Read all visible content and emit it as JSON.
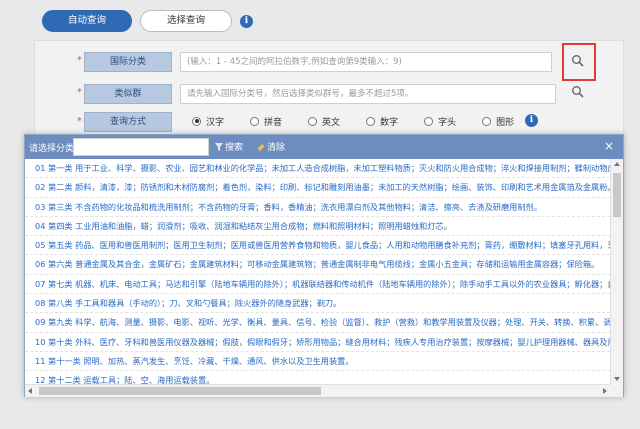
{
  "tabs": {
    "auto_query": "自动查询",
    "manual_query": "选择查询"
  },
  "form": {
    "intl_class_label": "国际分类",
    "intl_class_placeholder": "(输入：1 - 45之间的阿拉伯数字,例如查询第9类输入：9)",
    "similar_group_label": "类似群",
    "similar_group_placeholder": "请先输入国际分类号，然后选择类似群号，最多不超过5项。",
    "query_method_label": "查询方式",
    "methods": [
      "汉字",
      "拼音",
      "英文",
      "数字",
      "字头",
      "图形"
    ],
    "selected_method": "汉字"
  },
  "modal": {
    "title": "请选择分类",
    "search_label": "搜索",
    "clear_label": "清除",
    "close_symbol": "×",
    "items": [
      "01 第一类 用于工业、科学、摄影、农业、园艺和林业的化学品；未加工人造合成树脂，未加工塑料物质；灭火和防火用合成物；淬火和焊接用制剂；鞣制动物皮毛用物质；工",
      "02 第二类 颜料，清漆，漆；防锈剂和木材防腐剂；着色剂，染料；印刷、标记和雕刻用油墨；未加工的天然树脂；绘画、装饰、印刷和艺术用金属箔及金属粉。",
      "03 第三类 不含药物的化妆品和梳洗用制剂；不含药物的牙膏；香料，香精油；洗衣用漂白剂及其他物料；清洁、擦亮、去渍及研磨用制剂。",
      "04 第四类 工业用油和油脂，蜡；润滑剂；吸收、润湿和粘结灰尘用合成物；燃料和照明材料；照明用蜡烛和灯芯。",
      "05 第五类 药品、医用和兽医用制剂；医用卫生制剂；医用或兽医用营养食物和物质，婴儿食品；人用和动物用膳食补充剂；膏药，绷敷材料；填塞牙孔用料，牙科用蜡；消毒",
      "06 第六类 普通金属及其合金，金属矿石；金属建筑材料；可移动金属建筑物；普通金属制非电气用缆线；金属小五金具；存储和运输用金属容器；保险箱。",
      "07 第七类 机器、机床、电动工具；马达和引擎（陆地车辆用的除外）；机器联结器和传动机件（陆地车辆用的除外）；除手动手工具以外的农业器具；孵化器；自动售货机。",
      "08 第八类 手工具和器具（手动的）；刀、叉和勺餐具；除火器外的随身武器；剃刀。",
      "09 第九类 科学、航海、测量、摄影、电影、视听、光学、衡具、量具、信号、检验（监督）、救护（营救）和教学用装置及仪器；处理、开关、转换、积累、调节或控制电的装置和",
      "10 第十类 外科、医疗、牙科和兽医用仪器及器械；假肢，假眼和假牙；矫形用物品；缝合用材料；残疾人专用治疗装置；按摩器械；婴儿护理用器械、器具及用品；性生活用",
      "11 第十一类 照明、加热、蒸汽发生、烹饪、冷藏、干燥、通风、供水以及卫生用装置。",
      "12 第十二类 运载工具；陆、空、海用运载装置。"
    ]
  },
  "colors": {
    "primary": "#2f6bb5",
    "modal_header": "#6d8cc0",
    "link": "#2a6bc4",
    "highlight": "#e03a3a"
  }
}
